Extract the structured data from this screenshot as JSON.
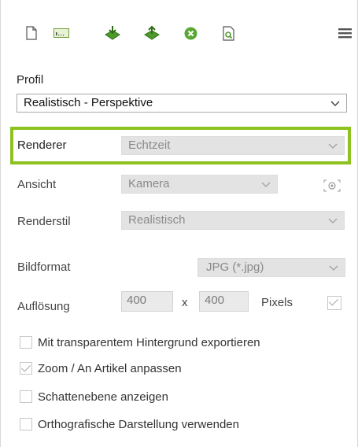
{
  "toolbar": {
    "icons": [
      "new-document-icon",
      "text-field-icon",
      "import-icon",
      "export-icon",
      "cancel-icon",
      "preview-icon",
      "menu-icon"
    ],
    "accent_green": "#4f9a2c",
    "highlight_color": "#8dc21f"
  },
  "profile": {
    "label": "Profil",
    "value": "Realistisch - Perspektive"
  },
  "renderer": {
    "label": "Renderer",
    "value": "Echtzeit"
  },
  "view": {
    "label": "Ansicht",
    "value": "Kamera"
  },
  "render_style": {
    "label": "Renderstil",
    "value": "Realistisch"
  },
  "image_format": {
    "label": "Bildformat",
    "value": "JPG (*.jpg)"
  },
  "resolution": {
    "label": "Auflösung",
    "width": "400",
    "separator": "x",
    "height": "400",
    "unit": "Pixels",
    "linked_checked": true
  },
  "options": [
    {
      "label": "Mit transparentem Hintergrund exportieren",
      "checked": false
    },
    {
      "label": "Zoom / An Artikel anpassen",
      "checked": true
    },
    {
      "label": "Schattenebene anzeigen",
      "checked": false
    },
    {
      "label": "Orthografische Darstellung verwenden",
      "checked": false
    }
  ]
}
